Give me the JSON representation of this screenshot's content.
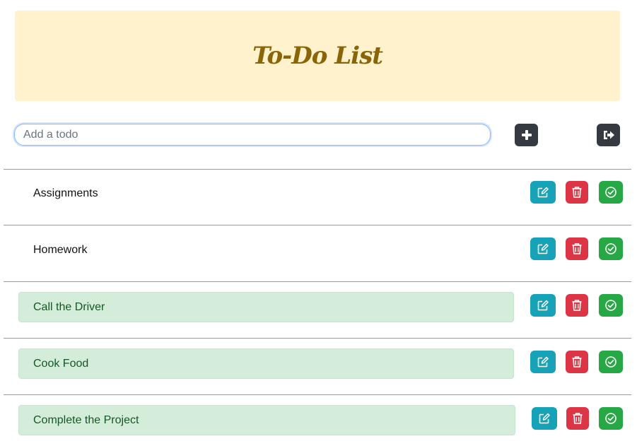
{
  "header": {
    "title": "To-Do List",
    "background": "#fff2cc",
    "title_color": "#8a6508"
  },
  "input": {
    "placeholder": "Add a todo",
    "value": ""
  },
  "toolbar": {
    "add_icon": "plus-icon",
    "logout_icon": "sign-out-icon"
  },
  "todos": [
    {
      "text": "Assignments",
      "completed": false
    },
    {
      "text": "Homework",
      "completed": false
    },
    {
      "text": "Call the Driver",
      "completed": true
    },
    {
      "text": "Cook Food",
      "completed": true
    },
    {
      "text": "Complete the Project",
      "completed": true
    }
  ],
  "colors": {
    "edit": "#17a2b8",
    "delete": "#dc3545",
    "complete": "#28a745",
    "dark": "#343a40",
    "completed_bg": "#d4edda",
    "completed_text": "#155724"
  },
  "actions": {
    "edit_icon": "edit-icon",
    "delete_icon": "trash-icon",
    "complete_icon": "check-circle-icon"
  }
}
